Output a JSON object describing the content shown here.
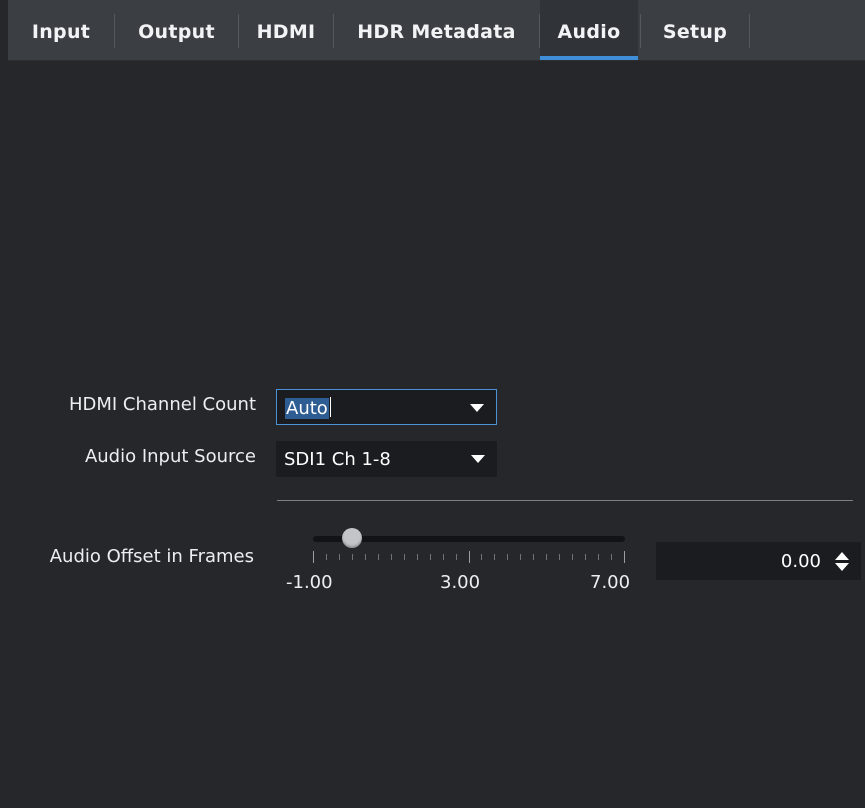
{
  "tabs": [
    {
      "label": "Input",
      "active": false
    },
    {
      "label": "Output",
      "active": false
    },
    {
      "label": "HDMI",
      "active": false
    },
    {
      "label": "HDR Metadata",
      "active": false
    },
    {
      "label": "Audio",
      "active": true
    },
    {
      "label": "Setup",
      "active": false
    }
  ],
  "colors": {
    "background": "#25272b",
    "tabbar": "#3b3e43",
    "accent": "#3e8fd8",
    "field_bg": "#1b1c1f"
  },
  "form": {
    "hdmi_channel_count": {
      "label": "HDMI Channel Count",
      "value": "Auto"
    },
    "audio_input_source": {
      "label": "Audio Input Source",
      "value": "SDI1 Ch 1-8"
    },
    "audio_offset": {
      "label": "Audio Offset in Frames",
      "value": "0.00",
      "slider": {
        "min": -1.0,
        "max": 7.0,
        "current": 0.0,
        "tick_labels": [
          "-1.00",
          "3.00",
          "7.00"
        ]
      }
    }
  }
}
